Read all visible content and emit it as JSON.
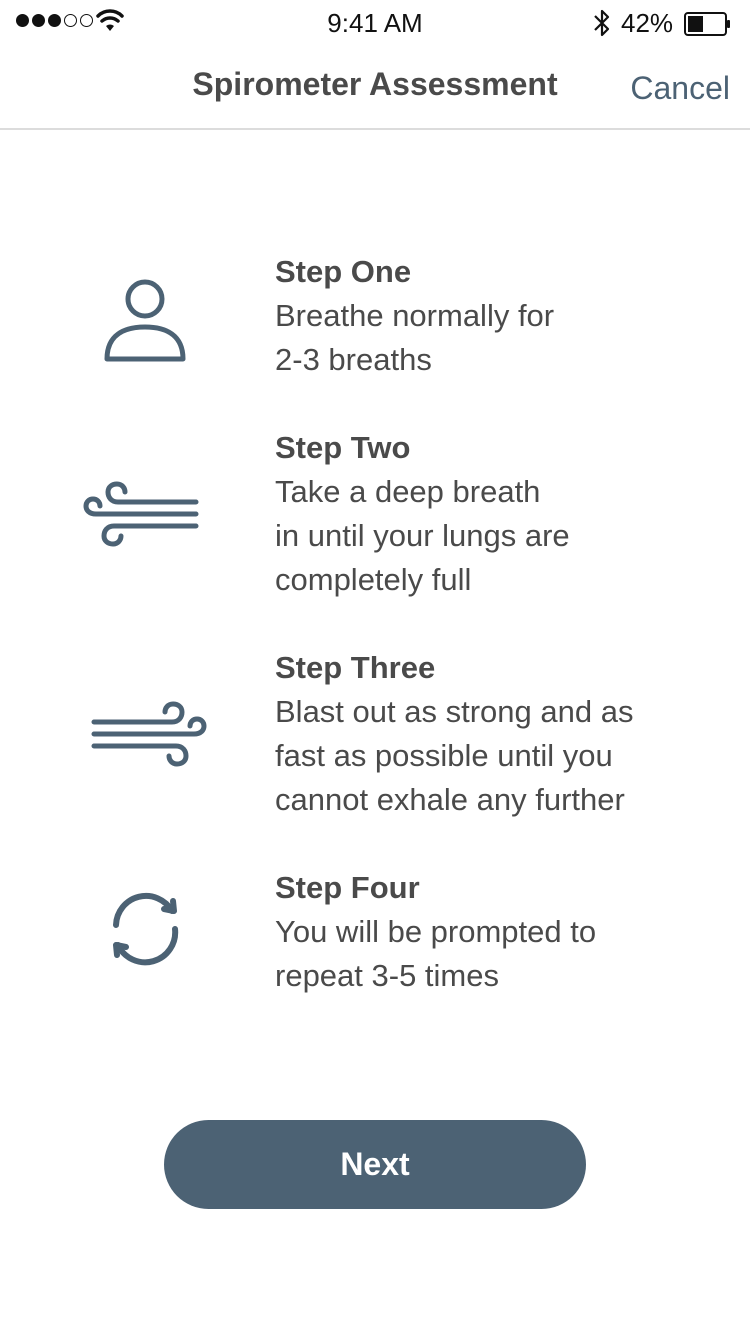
{
  "status_bar": {
    "time": "9:41 AM",
    "battery_percent": "42%",
    "signal_filled": 3,
    "signal_total": 5,
    "battery_level": 0.42
  },
  "nav": {
    "title": "Spirometer Assessment",
    "cancel_label": "Cancel"
  },
  "steps": [
    {
      "title": "Step One",
      "description": "Breathe normally for\n2-3 breaths",
      "icon": "person-icon"
    },
    {
      "title": "Step Two",
      "description": "Take a deep breath\nin until your lungs are\ncompletely full",
      "icon": "wind-in-icon"
    },
    {
      "title": "Step Three",
      "description": "Blast out as strong and as\nfast as possible until you\ncannot exhale any further",
      "icon": "wind-out-icon"
    },
    {
      "title": "Step Four",
      "description": "You will be prompted to\nrepeat 3-5 times",
      "icon": "repeat-icon"
    }
  ],
  "next_label": "Next",
  "colors": {
    "accent": "#4c6274",
    "text": "#4a4a4a",
    "divider": "#dcdcdc"
  }
}
